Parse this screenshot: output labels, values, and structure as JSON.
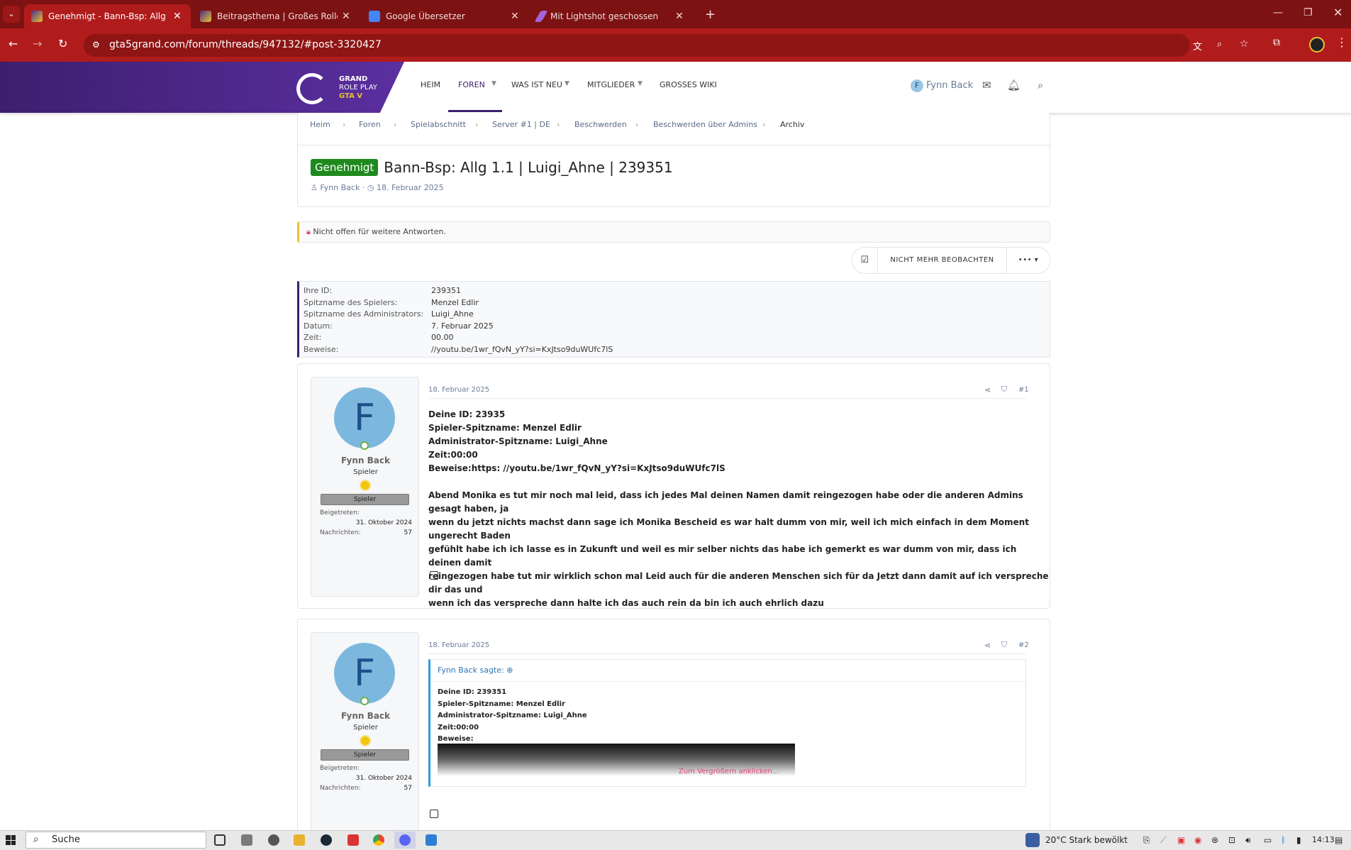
{
  "browser": {
    "tabs": [
      {
        "title": "Genehmigt - Bann-Bsp: Allg 1.1 | Luigi_Ahne | 239351",
        "active": true
      },
      {
        "title": "Beitragsthema | Großes Rollenspiel",
        "active": false
      },
      {
        "title": "Google Übersetzer",
        "active": false
      },
      {
        "title": "Mit Lightshot geschossen",
        "active": false
      }
    ],
    "url": "gta5grand.com/forum/threads/947132/#post-3320427"
  },
  "site": {
    "logo_lines": [
      "GRAND",
      "ROLE PLAY",
      "GTA V"
    ],
    "nav": [
      "HEIM",
      "FOREN",
      "WAS IST NEU",
      "MITGLIEDER",
      "GROSSES WIKI"
    ],
    "active_nav": "FOREN",
    "user": "Fynn Back",
    "user_initial": "F"
  },
  "breadcrumbs": [
    "Heim",
    "Foren",
    "Spielabschnitt",
    "Server #1 | DE",
    "Beschwerden",
    "Beschwerden über Admins",
    "Archiv"
  ],
  "thread": {
    "prefix": "Genehmigt",
    "title": "Bann-Bsp: Allg 1.1 | Luigi_Ahne | 239351",
    "author": "Fynn Back",
    "date": "18. Februar 2025",
    "notice": "Nicht offen für weitere Antworten.",
    "watch_label": "NICHT MEHR BEOBACHTEN",
    "more_label": "•••"
  },
  "info_fields": [
    {
      "label": "Ihre ID:",
      "value": "239351"
    },
    {
      "label": "Spitzname des Spielers:",
      "value": "Menzel Edlir"
    },
    {
      "label": "Spitzname des Administrators:",
      "value": "Luigi_Ahne"
    },
    {
      "label": "Datum:",
      "value": "7. Februar 2025"
    },
    {
      "label": "Zeit:",
      "value": "00.00"
    },
    {
      "label": "Beweise:",
      "value": "//youtu.be/1wr_fQvN_yY?si=KxJtso9duWUfc7lS"
    }
  ],
  "posts": [
    {
      "author": "Fynn Back",
      "initial": "F",
      "role": "Spieler",
      "banner": "Spieler",
      "joined_label": "Beigetreten:",
      "joined": "31. Oktober 2024",
      "messages_label": "Nachrichten:",
      "messages": "57",
      "date": "18. Februar 2025",
      "number": "#1",
      "lines": [
        "Deine ID: 23935",
        "Spieler-Spitzname: Menzel Edlir",
        "Administrator-Spitzname: Luigi_Ahne",
        "Zeit:00:00",
        "Beweise:https: //youtu.be/1wr_fQvN_yY?si=KxJtso9duWUfc7lS"
      ],
      "paragraph": [
        "Abend Monika es tut mir noch mal leid, dass ich jedes Mal deinen Namen damit reingezogen habe oder die anderen Admins gesagt haben, ja",
        "wenn du jetzt nichts machst dann sage ich Monika Bescheid es war halt dumm von mir, weil ich mich einfach in dem Moment ungerecht Baden",
        "gefühlt habe ich ich lasse es in Zukunft und weil es mir selber nichts das habe ich gemerkt es war dumm von mir, dass ich deinen damit",
        "reingezogen habe tut mir wirklich schon mal Leid auch für die anderen Menschen sich für da Jetzt dann damit auf ich verspreche dir das und",
        "wenn ich das verspreche dann halte ich das auch rein da bin ich auch ehrlich dazu"
      ]
    },
    {
      "author": "Fynn Back",
      "initial": "F",
      "role": "Spieler",
      "banner": "Spieler",
      "joined_label": "Beigetreten:",
      "joined": "31. Oktober 2024",
      "messages_label": "Nachrichten:",
      "messages": "57",
      "date": "18. Februar 2025",
      "number": "#2",
      "quote_head": "Fynn Back sagte:",
      "quote_lines": [
        "Deine ID: 239351",
        "Spieler-Spitzname: Menzel Edlir",
        "Administrator-Spitzname: Luigi_Ahne",
        "Zeit:00:00",
        "Beweise:"
      ],
      "quote_zoom": "Zum Vergrößern anklicken..."
    }
  ],
  "taskbar": {
    "search": "Suche",
    "weather": "20°C  Stark bewölkt",
    "time": "14:13"
  }
}
